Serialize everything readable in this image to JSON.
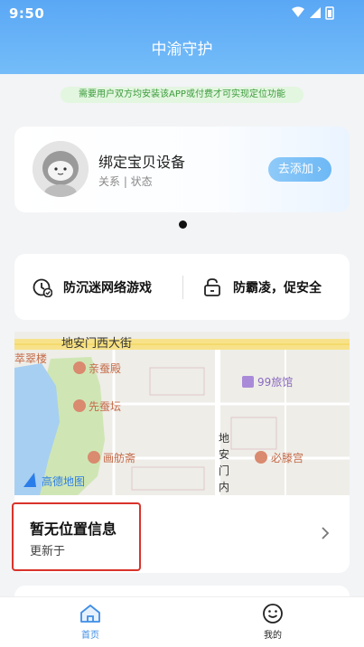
{
  "status_bar": {
    "time": "9:50"
  },
  "header": {
    "title": "中渝守护"
  },
  "notice": {
    "text": "需要用户双方均安装该APP或付费才可实现定位功能"
  },
  "device_card": {
    "title": "绑定宝贝设备",
    "subtitle": "关系 | 状态",
    "add_button": "去添加 ›"
  },
  "features": [
    {
      "label": "防沉迷网络游戏",
      "icon": "clock-check-icon"
    },
    {
      "label": "防霸凌，促安全",
      "icon": "lock-icon"
    }
  ],
  "map": {
    "labels": {
      "street": "地安门西大街",
      "cuicuilou": "萃翠楼",
      "qincandian": "亲蚕殿",
      "xiancantan": "先蚕坛",
      "huafangzhai": "画舫斋",
      "hotel": "99旅馆",
      "dianmen": "地安门内",
      "bitenggong": "必滕宫",
      "logo": "高德地图"
    }
  },
  "location_card": {
    "title": "暂无位置信息",
    "subtitle": "更新于"
  },
  "tabbar": {
    "home": "首页",
    "mine": "我的"
  },
  "colors": {
    "header": "#5aa7f5",
    "accent": "#3e8de6",
    "highlight": "#d9332b"
  }
}
